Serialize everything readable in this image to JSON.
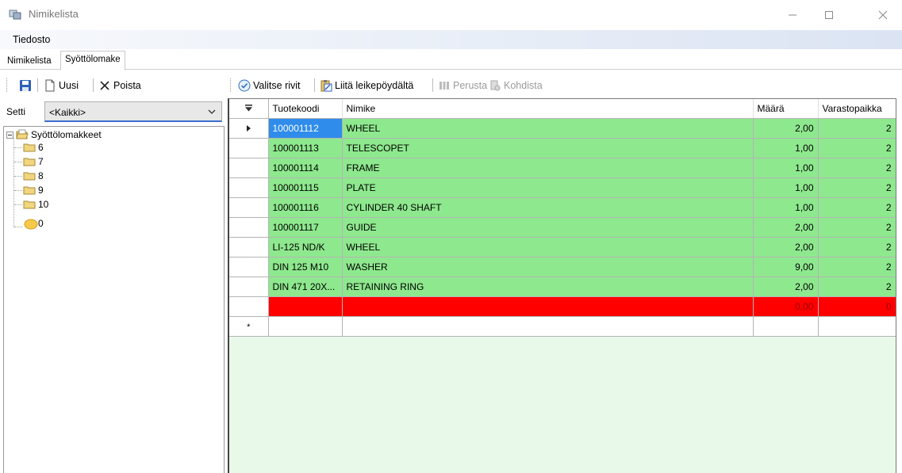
{
  "window": {
    "title": "Nimikelista"
  },
  "menu": {
    "file": "Tiedosto"
  },
  "tabs": [
    {
      "label": "Nimikelista"
    },
    {
      "label": "Syöttölomake"
    }
  ],
  "left_toolbar": {
    "new_label": "Uusi",
    "delete_label": "Poista"
  },
  "right_toolbar": {
    "select_rows_label": "Valitse rivit",
    "paste_clipboard_label": "Liitä leikepöydältä",
    "basic_label": "Perusta",
    "target_label": "Kohdista"
  },
  "setti": {
    "label": "Setti",
    "value": "<Kaikki>"
  },
  "tree": {
    "root": "Syöttölomakkeet",
    "children": [
      "6",
      "7",
      "8",
      "9",
      "10",
      "0"
    ]
  },
  "grid": {
    "columns": [
      "Tuotekoodi",
      "Nimike",
      "Määrä",
      "Varastopaikka"
    ],
    "rows": [
      {
        "code": "100001112",
        "name": "WHEEL",
        "qty": "2,00",
        "loc": "2"
      },
      {
        "code": "100001113",
        "name": "TELESCOPET",
        "qty": "1,00",
        "loc": "2"
      },
      {
        "code": "100001114",
        "name": "FRAME",
        "qty": "1,00",
        "loc": "2"
      },
      {
        "code": "100001115",
        "name": "PLATE",
        "qty": "1,00",
        "loc": "2"
      },
      {
        "code": "100001116",
        "name": "CYLINDER 40 SHAFT",
        "qty": "1,00",
        "loc": "2"
      },
      {
        "code": "100001117",
        "name": "GUIDE",
        "qty": "2,00",
        "loc": "2"
      },
      {
        "code": "LI-125 ND/K",
        "name": "WHEEL",
        "qty": "2,00",
        "loc": "2"
      },
      {
        "code": "DIN 125 M10",
        "name": "WASHER",
        "qty": "9,00",
        "loc": "2"
      },
      {
        "code": "DIN 471 20X...",
        "name": "RETAINING RING",
        "qty": "2,00",
        "loc": "2"
      }
    ],
    "error_row": {
      "code": "",
      "name": "",
      "qty": "0,00",
      "loc": "0"
    },
    "new_row_marker": "*"
  },
  "colors": {
    "row_ok": "#8ee88e",
    "row_error": "#ff0000",
    "selection": "#2f8cea",
    "grid_background": "#e9f9e9"
  }
}
